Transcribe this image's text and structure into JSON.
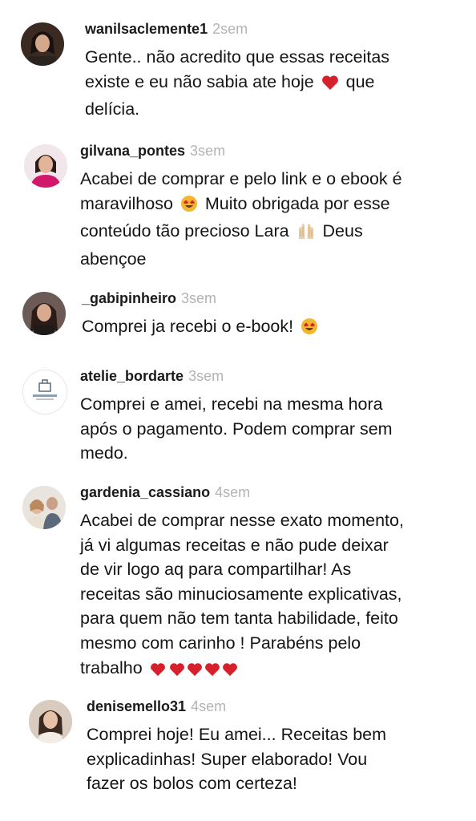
{
  "comments": [
    {
      "username": "wanilsaclemente1",
      "time": "2sem",
      "lines": [
        "Gente.. não acredito que essas receitas",
        "existe e eu não sabia ate hoje ",
        " que",
        "delícia."
      ]
    },
    {
      "username": "gilvana_pontes",
      "time": "3sem",
      "lines": [
        "Acabei de comprar e pelo link e o ebook é",
        "maravilhoso ",
        " Muito obrigada por esse",
        "conteúdo tão precioso Lara ",
        " Deus",
        "abençoe"
      ]
    },
    {
      "username": "_gabipinheiro",
      "time": "3sem",
      "lines": [
        "Comprei ja recebi o e-book! "
      ]
    },
    {
      "username": "atelie_bordarte",
      "time": "3sem",
      "lines": [
        "Comprei e amei, recebi na mesma hora",
        "após o pagamento. Podem comprar sem",
        "medo."
      ]
    },
    {
      "username": "gardenia_cassiano",
      "time": "4sem",
      "lines": [
        "Acabei de comprar nesse exato momento,",
        "já vi algumas receitas e não pude deixar",
        "de vir logo aq para compartilhar! As",
        "receitas são minuciosamente explicativas,",
        "para quem não tem tanta habilidade, feito",
        "mesmo com carinho ! Parabéns pelo",
        "trabalho "
      ]
    },
    {
      "username": "denisemello31",
      "time": "4sem",
      "lines": [
        "Comprei hoje! Eu amei... Receitas bem",
        "explicadinhas! Super elaborado! Vou",
        "fazer os bolos com certeza!"
      ]
    }
  ],
  "icons": {
    "heart": "red-heart-icon",
    "heart_eyes": "heart-eyes-emoji-icon",
    "raising_hands": "raising-hands-emoji-icon"
  },
  "colors": {
    "heart": "#d6202b",
    "emoji_face": "#f5b62f",
    "time": "#b3b3b3"
  }
}
